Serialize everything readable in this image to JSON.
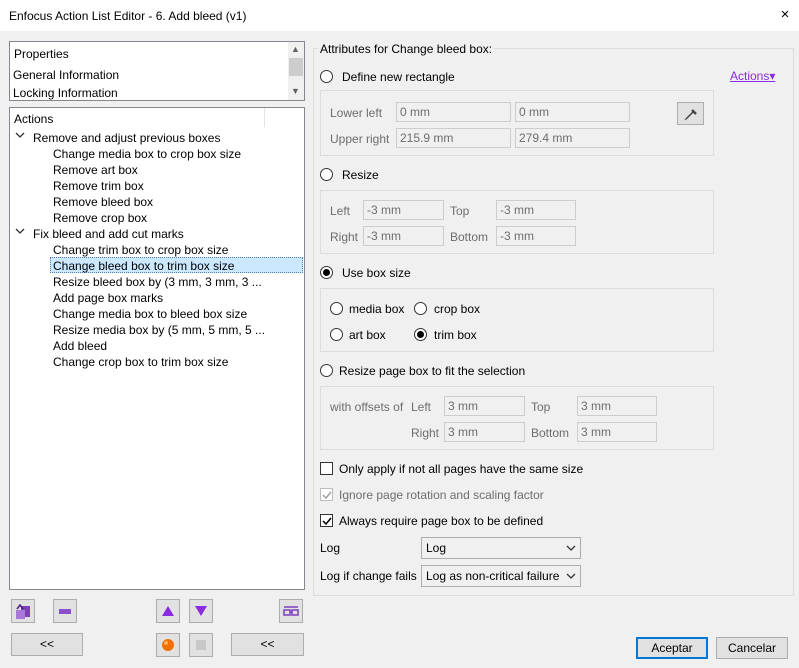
{
  "window": {
    "title": "Enfocus Action List Editor - 6. Add bleed (v1)",
    "close_glyph": "×"
  },
  "properties_panel": {
    "header": "Properties",
    "items": [
      "General Information",
      "Locking Information"
    ]
  },
  "actions_panel": {
    "header": "Actions",
    "groups": [
      {
        "label": "Remove and adjust previous boxes",
        "items": [
          "Change media box to crop box size",
          "Remove art box",
          "Remove trim box",
          "Remove bleed box",
          "Remove crop box"
        ]
      },
      {
        "label": "Fix bleed and add cut marks",
        "items": [
          "Change trim box to crop box size",
          "Change bleed box to trim box size",
          "Resize bleed box by (3 mm, 3 mm, 3 ...",
          "Add page box marks",
          "Change media box to bleed box size",
          "Resize media box by (5 mm, 5 mm, 5 ...",
          "Add bleed",
          "Change crop box to trim box size"
        ]
      }
    ],
    "selected_item": "Change bleed box to trim box size"
  },
  "bottom_left": {
    "back_label_1": "<<",
    "back_label_2": "<<"
  },
  "attributes": {
    "heading": "Attributes for Change bleed box:",
    "actions_link": "Actions",
    "define_new_rectangle": {
      "label": "Define new rectangle",
      "lower_left_label": "Lower left",
      "lower_left_x": "0 mm",
      "lower_left_y": "0 mm",
      "upper_right_label": "Upper right",
      "upper_right_x": "215.9 mm",
      "upper_right_y": "279.4 mm"
    },
    "resize": {
      "label": "Resize",
      "left_label": "Left",
      "left_value": "-3 mm",
      "top_label": "Top",
      "top_value": "-3 mm",
      "right_label": "Right",
      "right_value": "-3 mm",
      "bottom_label": "Bottom",
      "bottom_value": "-3 mm"
    },
    "use_box_size": {
      "label": "Use box size",
      "options": {
        "media": "media box",
        "crop": "crop box",
        "art": "art box",
        "trim": "trim box"
      },
      "selected": "trim box"
    },
    "fit_selection": {
      "label": "Resize page box to fit the selection",
      "offsets_label": "with offsets of",
      "left_label": "Left",
      "left_value": "3 mm",
      "top_label": "Top",
      "top_value": "3 mm",
      "right_label": "Right",
      "right_value": "3 mm",
      "bottom_label": "Bottom",
      "bottom_value": "3 mm"
    },
    "selected_mode": "Use box size",
    "checkboxes": {
      "only_apply": {
        "label": "Only apply if not all pages have the same size",
        "checked": false
      },
      "ignore_rotation": {
        "label": "Ignore page rotation and scaling factor",
        "checked": true,
        "disabled": true
      },
      "always_require": {
        "label": "Always require page box to be defined",
        "checked": true
      }
    },
    "log": {
      "label": "Log",
      "value": "Log"
    },
    "log_fail": {
      "label": "Log if change fails",
      "value": "Log as non-critical failure"
    }
  },
  "dialog_buttons": {
    "accept": "Aceptar",
    "cancel": "Cancelar"
  },
  "colors": {
    "accent_purple": "#8a2be2",
    "selection_bg": "#cce8ff",
    "record_orange": "#f07000"
  }
}
